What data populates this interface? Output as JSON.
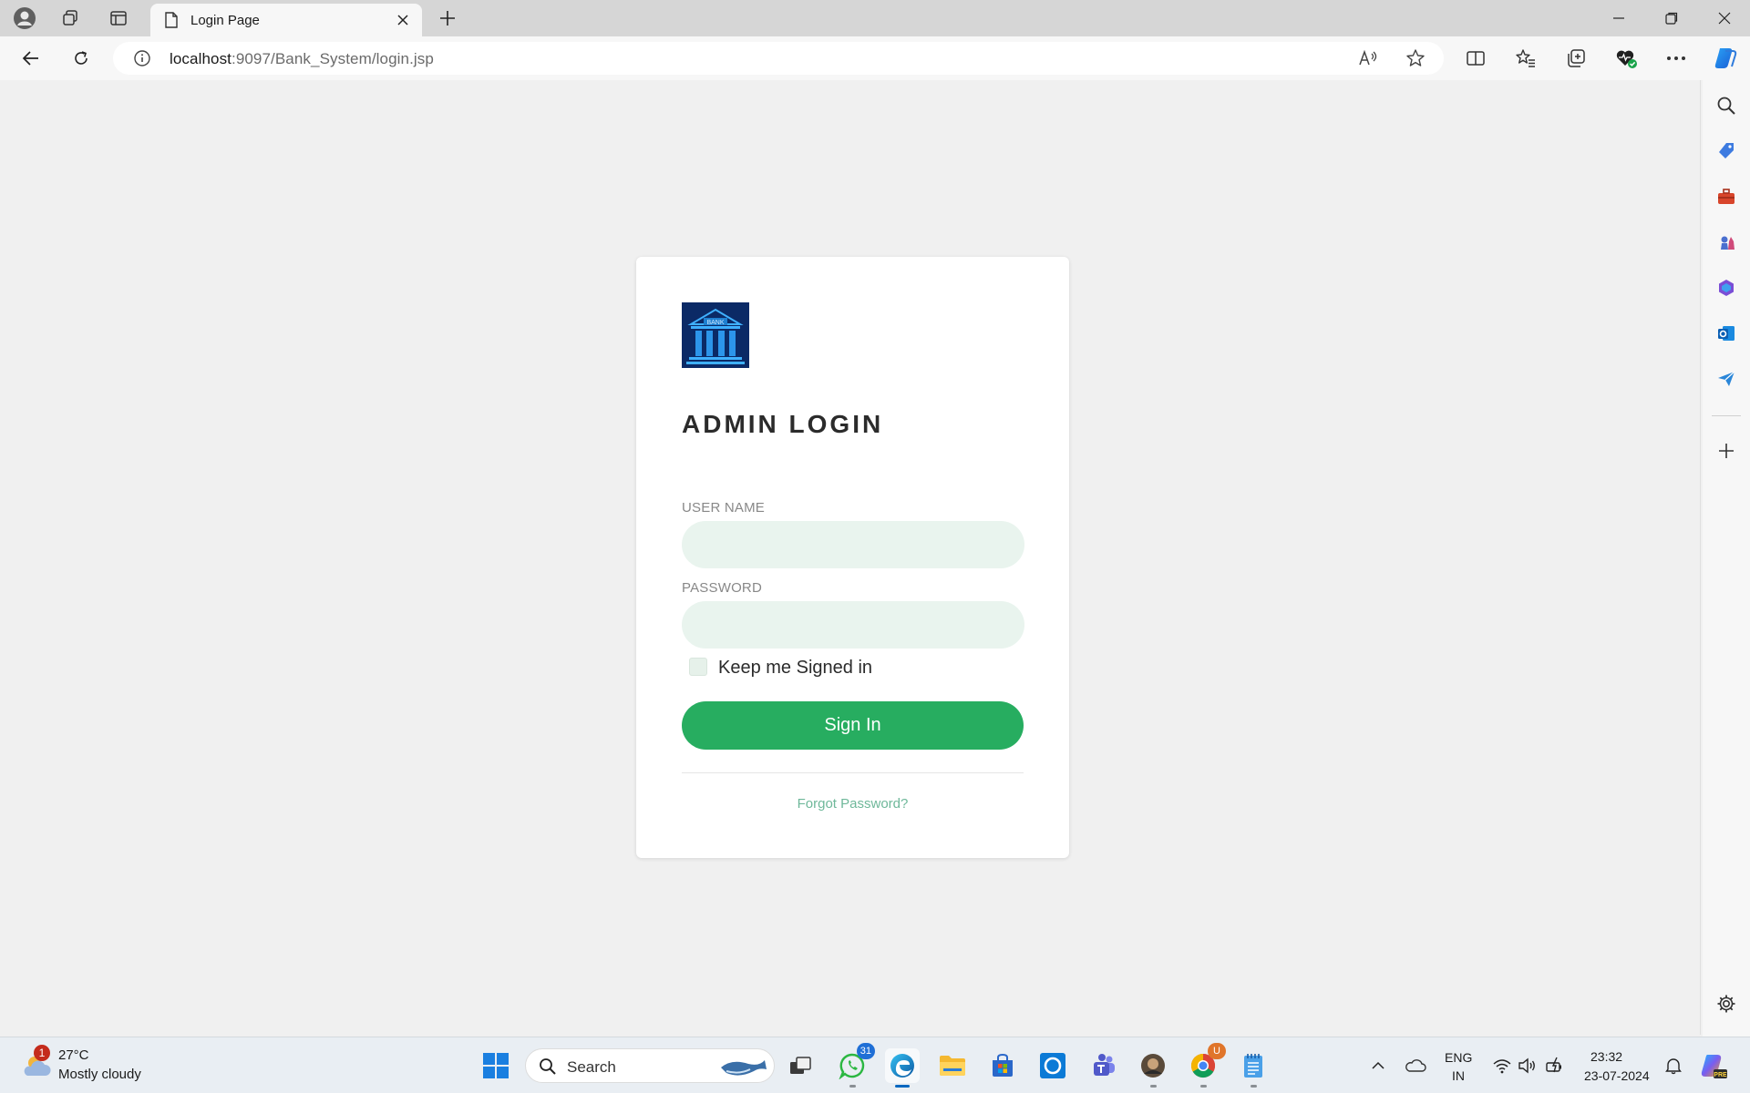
{
  "browser": {
    "tab": {
      "title": "Login Page"
    },
    "address": {
      "host": "localhost",
      "path": ":9097/Bank_System/login.jsp"
    }
  },
  "login": {
    "logo_text": "BANK",
    "title": "ADMIN LOGIN",
    "username_label": "USER NAME",
    "username_value": "",
    "password_label": "PASSWORD",
    "password_value": "",
    "keep_signed_in_label": "Keep me Signed in",
    "keep_signed_in_checked": false,
    "signin_label": "Sign In",
    "forgot_label": "Forgot Password?"
  },
  "colors": {
    "accent_green": "#27ad60",
    "input_bg": "#e9f4ee",
    "link_green": "#6fb89a",
    "logo_bg": "#0b2a66"
  },
  "taskbar": {
    "weather": {
      "badge": "1",
      "temp": "27°C",
      "condition": "Mostly cloudy"
    },
    "search_label": "Search",
    "whatsapp_badge": "31",
    "chrome_badge": "U",
    "language_line1": "ENG",
    "language_line2": "IN",
    "time": "23:32",
    "date": "23-07-2024"
  }
}
